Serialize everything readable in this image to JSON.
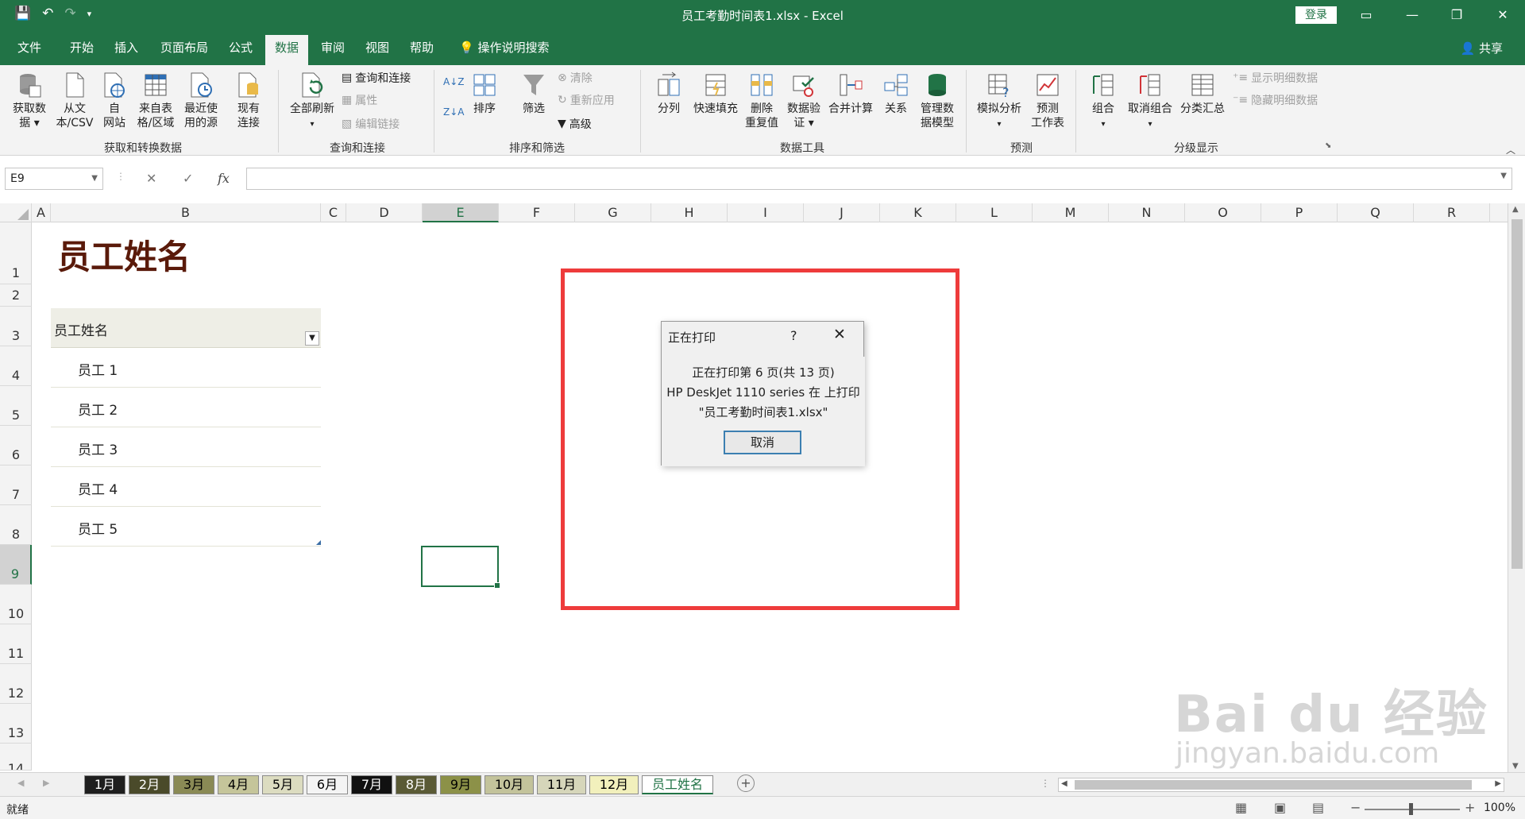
{
  "titlebar": {
    "title": "员工考勤时间表1.xlsx  -  Excel",
    "login": "登录",
    "qat": [
      "💾",
      "↶",
      "↷",
      "▾"
    ],
    "window_btns": [
      "▭",
      "—",
      "❐",
      "✕"
    ]
  },
  "tabs": [
    "文件",
    "开始",
    "插入",
    "页面布局",
    "公式",
    "数据",
    "审阅",
    "视图",
    "帮助",
    "操作说明搜索"
  ],
  "active_tab": "数据",
  "share": "共享",
  "ribbon": {
    "get_data": {
      "l1": "获取数",
      "l2": "据 ▾"
    },
    "from_csv": {
      "l1": "从文",
      "l2": "本/CSV"
    },
    "from_web": {
      "l1": "自",
      "l2": "网站"
    },
    "from_table": {
      "l1": "来自表",
      "l2": "格/区域"
    },
    "recent": {
      "l1": "最近使",
      "l2": "用的源"
    },
    "existing": {
      "l1": "现有",
      "l2": "连接"
    },
    "refresh": {
      "l1": "全部刷新",
      "l2": "▾"
    },
    "queries": "查询和连接",
    "properties": "属性",
    "edit_links": "编辑链接",
    "sort": "排序",
    "filter": "筛选",
    "clear": "清除",
    "reapply": "重新应用",
    "advanced": "高级",
    "split": "分列",
    "flash_fill": "快速填充",
    "remove_dup": {
      "l1": "删除",
      "l2": "重复值"
    },
    "validation": {
      "l1": "数据验",
      "l2": "证 ▾"
    },
    "consolidate": "合并计算",
    "relations": "关系",
    "data_model": {
      "l1": "管理数",
      "l2": "据模型"
    },
    "whatif": {
      "l1": "模拟分析",
      "l2": "▾"
    },
    "forecast": {
      "l1": "预测",
      "l2": "工作表"
    },
    "group": {
      "l1": "组合",
      "l2": "▾"
    },
    "ungroup": {
      "l1": "取消组合",
      "l2": "▾"
    },
    "subtotal": "分类汇总",
    "show_detail": "显示明细数据",
    "hide_detail": "隐藏明细数据",
    "groups": [
      "获取和转换数据",
      "查询和连接",
      "排序和筛选",
      "数据工具",
      "预测",
      "分级显示"
    ]
  },
  "formula_bar": {
    "namebox": "E9",
    "cancel": "✕",
    "enter": "✓",
    "fx": "fx",
    "formula": ""
  },
  "columns": [
    "A",
    "B",
    "C",
    "D",
    "E",
    "F",
    "G",
    "H",
    "I",
    "J",
    "K",
    "L",
    "M",
    "N",
    "O",
    "P",
    "Q",
    "R"
  ],
  "selected_column": "E",
  "rows": [
    "1",
    "2",
    "3",
    "4",
    "5",
    "6",
    "7",
    "8",
    "9",
    "10",
    "11",
    "12",
    "13",
    "14"
  ],
  "selected_row": "9",
  "sheet": {
    "title": "员工姓名",
    "table_header": "员工姓名",
    "employees": [
      "员工 1",
      "员工 2",
      "员工 3",
      "员工 4",
      "员工 5"
    ]
  },
  "dialog": {
    "title": "正在打印",
    "help": "?",
    "close": "✕",
    "line1": "正在打印第 6 页(共 13 页)",
    "line2": "HP DeskJet 1110 series 在  上打印",
    "line3": "\"员工考勤时间表1.xlsx\"",
    "cancel": "取消"
  },
  "sheet_tabs": [
    {
      "label": "1月",
      "bg": "#1e1e1e",
      "fg": "#ffffff"
    },
    {
      "label": "2月",
      "bg": "#4a4a2a",
      "fg": "#ffffff"
    },
    {
      "label": "3月",
      "bg": "#8a8a55",
      "fg": "#000000"
    },
    {
      "label": "4月",
      "bg": "#c5c59a",
      "fg": "#000000"
    },
    {
      "label": "5月",
      "bg": "#dcdcc0",
      "fg": "#000000"
    },
    {
      "label": "6月",
      "bg": "#f4f4f4",
      "fg": "#000000"
    },
    {
      "label": "7月",
      "bg": "#111111",
      "fg": "#ffffff"
    },
    {
      "label": "8月",
      "bg": "#5a5a35",
      "fg": "#ffffff"
    },
    {
      "label": "9月",
      "bg": "#8c9148",
      "fg": "#000000"
    },
    {
      "label": "10月",
      "bg": "#c3c39b",
      "fg": "#000000"
    },
    {
      "label": "11月",
      "bg": "#d6d6ba",
      "fg": "#000000"
    },
    {
      "label": "12月",
      "bg": "#f2f0bc",
      "fg": "#000000"
    },
    {
      "label": "员工姓名",
      "bg": "#ffffff",
      "fg": "#217346"
    }
  ],
  "active_sheet": "员工姓名",
  "status": {
    "text": "就绪",
    "zoom": "100%"
  },
  "watermark": {
    "brand": "Bai  du 经验",
    "url": "jingyan.baidu.com"
  },
  "colors": {
    "accent": "#217346",
    "highlight": "#ee3b3b",
    "title_text": "#5a1a0a"
  }
}
